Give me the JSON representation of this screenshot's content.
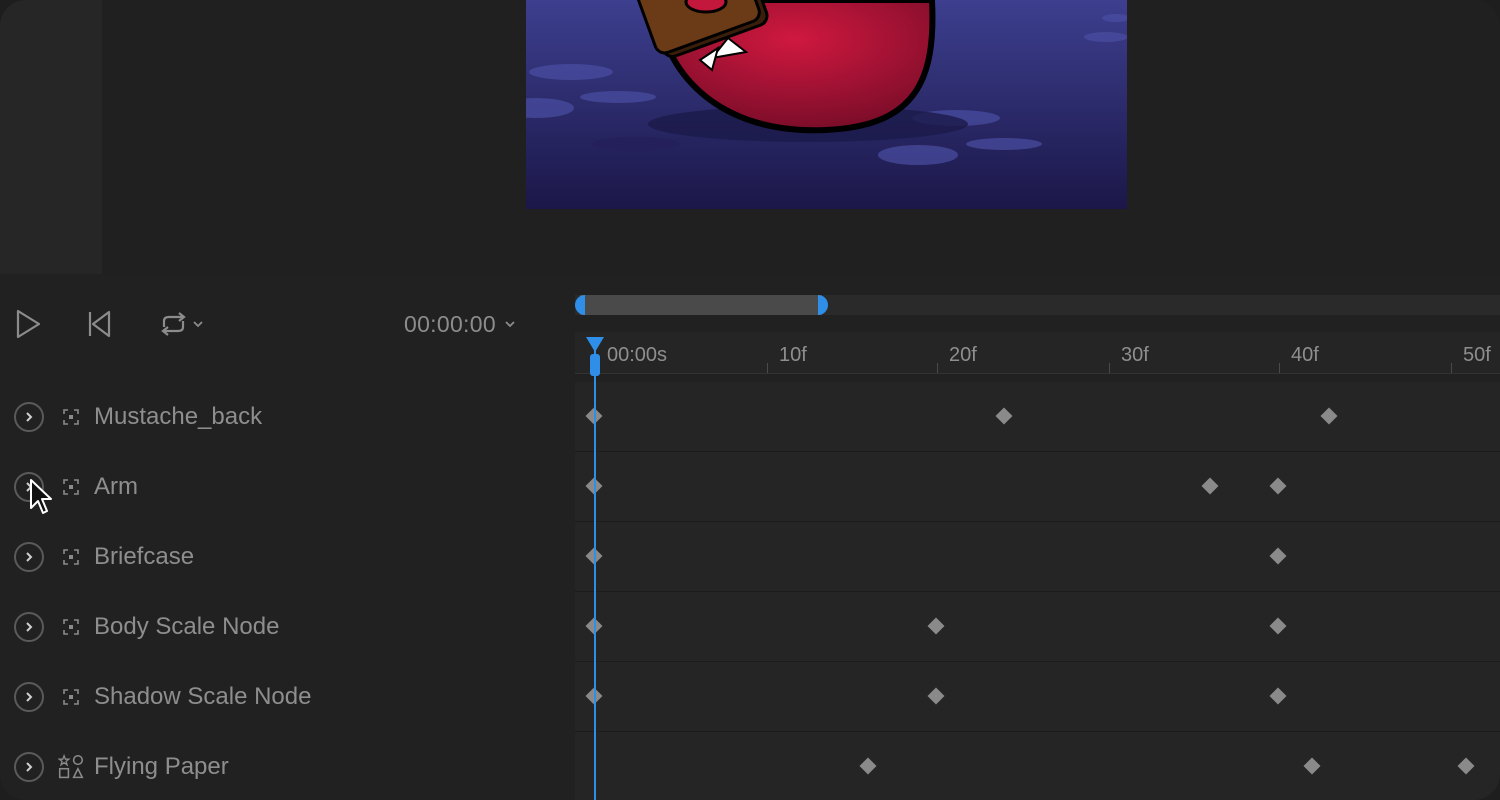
{
  "transport": {
    "play_icon": "play-icon",
    "rewind_icon": "skip-to-start-icon",
    "loop_icon": "loop-icon",
    "current_time": "00:00:00"
  },
  "ruler": {
    "labels": [
      "00:00s",
      "10f",
      "20f",
      "30f",
      "40f",
      "50f"
    ]
  },
  "layers": [
    {
      "name": "Mustache_back",
      "icon": "node-icon"
    },
    {
      "name": "Arm",
      "icon": "node-icon"
    },
    {
      "name": "Briefcase",
      "icon": "node-icon"
    },
    {
      "name": "Body Scale Node",
      "icon": "node-icon"
    },
    {
      "name": "Shadow Scale Node",
      "icon": "node-icon"
    },
    {
      "name": "Flying Paper",
      "icon": "shapes-icon"
    }
  ],
  "keyframes": [
    [
      0,
      24,
      43
    ],
    [
      0,
      36,
      40
    ],
    [
      0,
      40
    ],
    [
      0,
      20,
      40
    ],
    [
      0,
      20,
      40
    ],
    [
      16,
      42,
      51
    ]
  ],
  "colors": {
    "accent": "#2f8fe8",
    "keyframe": "#8a8a8a"
  }
}
